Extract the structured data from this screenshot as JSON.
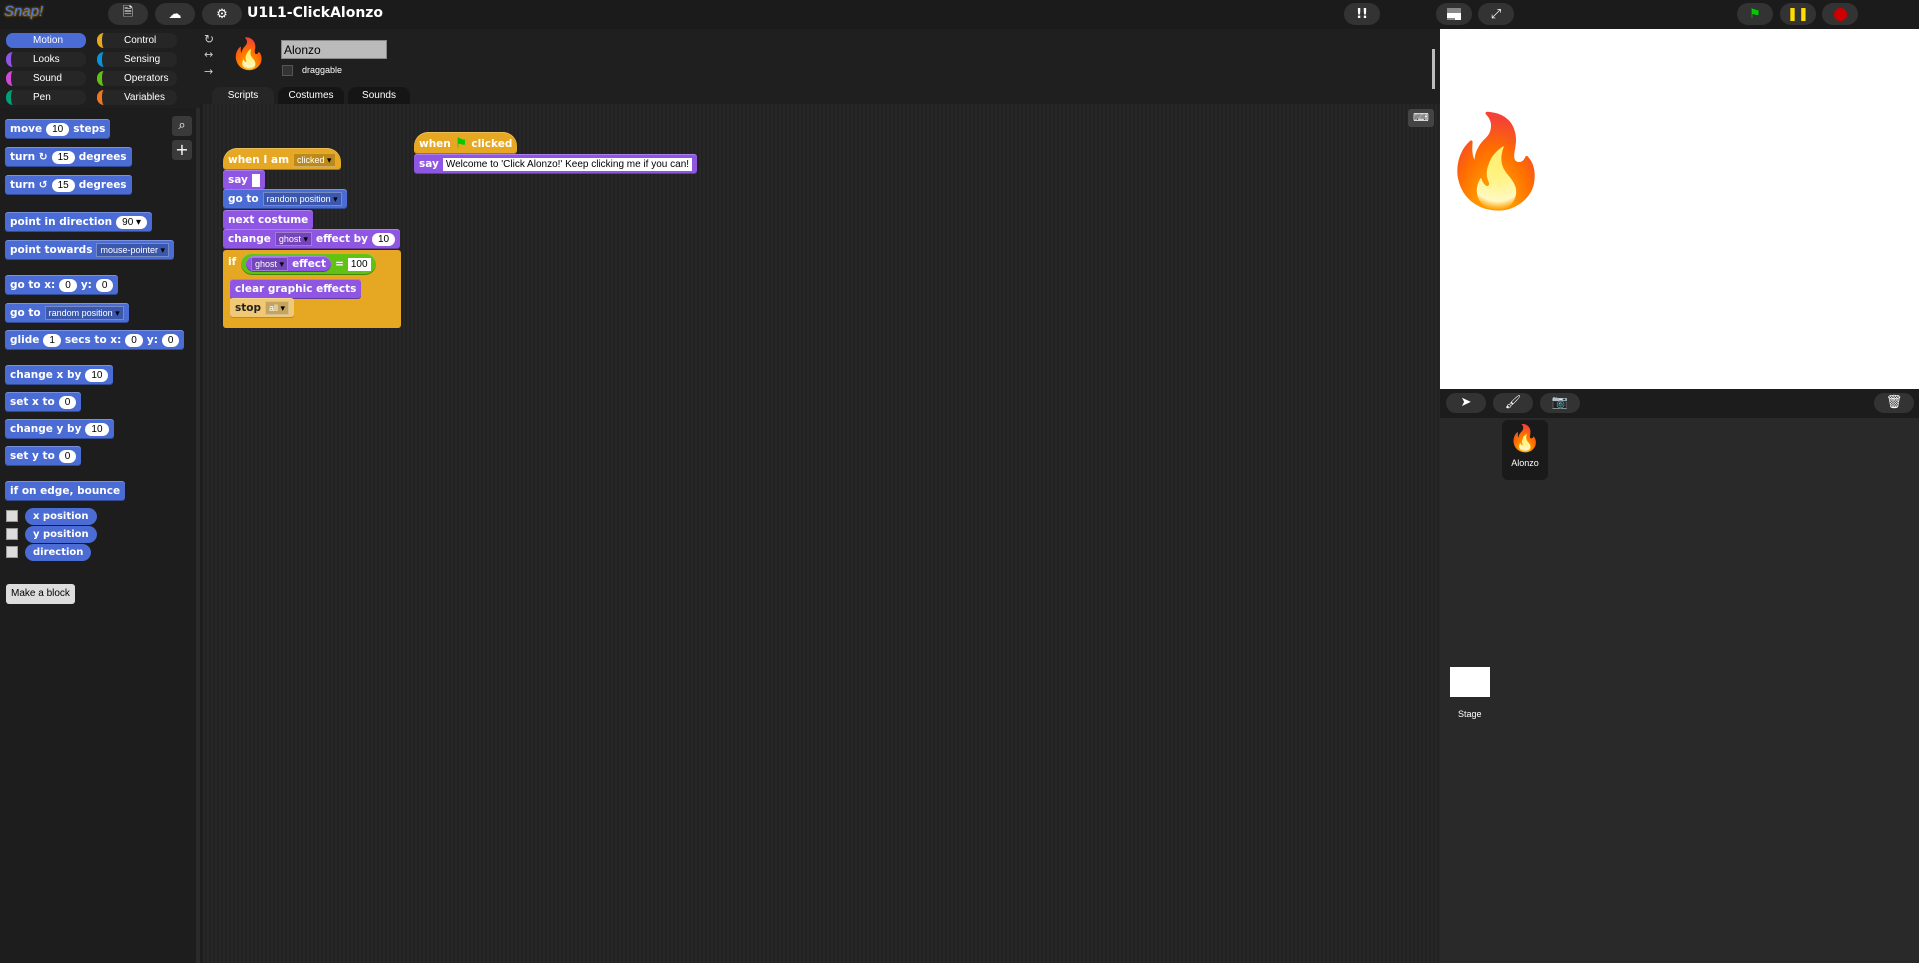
{
  "app": {
    "logo": "Snap!",
    "title": "U1L1-ClickAlonzo",
    "accent": "#4a6cd4"
  },
  "topbar": {
    "icons": [
      "file-icon",
      "cloud-icon",
      "gear-icon",
      "exclamation-icon",
      "stage-size-icon",
      "fullscreen-icon",
      "green-flag-icon",
      "pause-icon",
      "stop-icon"
    ]
  },
  "categories": [
    {
      "label": "Motion",
      "color": "#4a6cd4",
      "selected": true
    },
    {
      "label": "Control",
      "color": "#e6a822"
    },
    {
      "label": "Looks",
      "color": "#8f56e3"
    },
    {
      "label": "Sensing",
      "color": "#0494dc"
    },
    {
      "label": "Sound",
      "color": "#cf4ad9"
    },
    {
      "label": "Operators",
      "color": "#62c213"
    },
    {
      "label": "Pen",
      "color": "#00a178"
    },
    {
      "label": "Variables",
      "color": "#f3761d"
    }
  ],
  "palette": {
    "blocks": [
      [
        {
          "t": "move"
        },
        {
          "n": "10"
        },
        {
          "t": "steps"
        }
      ],
      [
        {
          "t": "turn ↻"
        },
        {
          "n": "15"
        },
        {
          "t": "degrees"
        }
      ],
      [
        {
          "t": "turn ↺"
        },
        {
          "n": "15"
        },
        {
          "t": "degrees"
        }
      ],
      [
        {
          "t": "point in direction"
        },
        {
          "n": "90 ▾"
        }
      ],
      [
        {
          "t": "point towards"
        },
        {
          "d": "mouse-pointer"
        }
      ],
      [
        {
          "t": "go to x:"
        },
        {
          "n": "0"
        },
        {
          "t": "y:"
        },
        {
          "n": "0"
        }
      ],
      [
        {
          "t": "go to"
        },
        {
          "d": "random position"
        }
      ],
      [
        {
          "t": "glide"
        },
        {
          "n": "1"
        },
        {
          "t": "secs to x:"
        },
        {
          "n": "0"
        },
        {
          "t": "y:"
        },
        {
          "n": "0"
        }
      ],
      [
        {
          "t": "change x by"
        },
        {
          "n": "10"
        }
      ],
      [
        {
          "t": "set x to"
        },
        {
          "n": "0"
        }
      ],
      [
        {
          "t": "change y by"
        },
        {
          "n": "10"
        }
      ],
      [
        {
          "t": "set y to"
        },
        {
          "n": "0"
        }
      ],
      [
        {
          "t": "if on edge, bounce"
        }
      ]
    ],
    "reporters": [
      "x position",
      "y position",
      "direction"
    ],
    "make_block": "Make a block"
  },
  "sprite": {
    "name": "Alonzo",
    "draggable_label": "draggable",
    "draggable": false,
    "tabs": [
      "Scripts",
      "Costumes",
      "Sounds"
    ],
    "active_tab": "Scripts"
  },
  "scripts": [
    {
      "hat": [
        {
          "t": "when I am"
        },
        {
          "d": "clicked"
        }
      ],
      "blocks": [
        {
          "c": "looks",
          "p": [
            {
              "t": "say"
            },
            {
              "s": ""
            }
          ]
        },
        {
          "c": "motion",
          "p": [
            {
              "t": "go to"
            },
            {
              "d": "random position"
            }
          ]
        },
        {
          "c": "looks",
          "p": [
            {
              "t": "next costume"
            }
          ]
        },
        {
          "c": "looks",
          "p": [
            {
              "t": "change"
            },
            {
              "d": "ghost"
            },
            {
              "t": "effect by"
            },
            {
              "n": "10"
            }
          ]
        }
      ],
      "if": {
        "label": "if",
        "cond": [
          {
            "d": "ghost"
          },
          {
            "t": "effect"
          }
        ],
        "eq": "=",
        "val": "100",
        "body": [
          {
            "c": "looks",
            "p": [
              {
                "t": "clear graphic effects"
              }
            ]
          },
          {
            "c": "ctl2",
            "p": [
              {
                "t": "stop"
              },
              {
                "d": "all"
              }
            ]
          }
        ]
      }
    },
    {
      "hat": [
        {
          "t": "when"
        },
        {
          "f": "green-flag"
        },
        {
          "t": "clicked"
        }
      ],
      "blocks": [
        {
          "c": "looks",
          "p": [
            {
              "t": "say"
            },
            {
              "s": "Welcome to 'Click Alonzo!' Keep clicking me if you can!"
            }
          ]
        }
      ]
    }
  ],
  "corral": {
    "sprites": [
      {
        "name": "Alonzo"
      }
    ],
    "stage_label": "Stage"
  }
}
